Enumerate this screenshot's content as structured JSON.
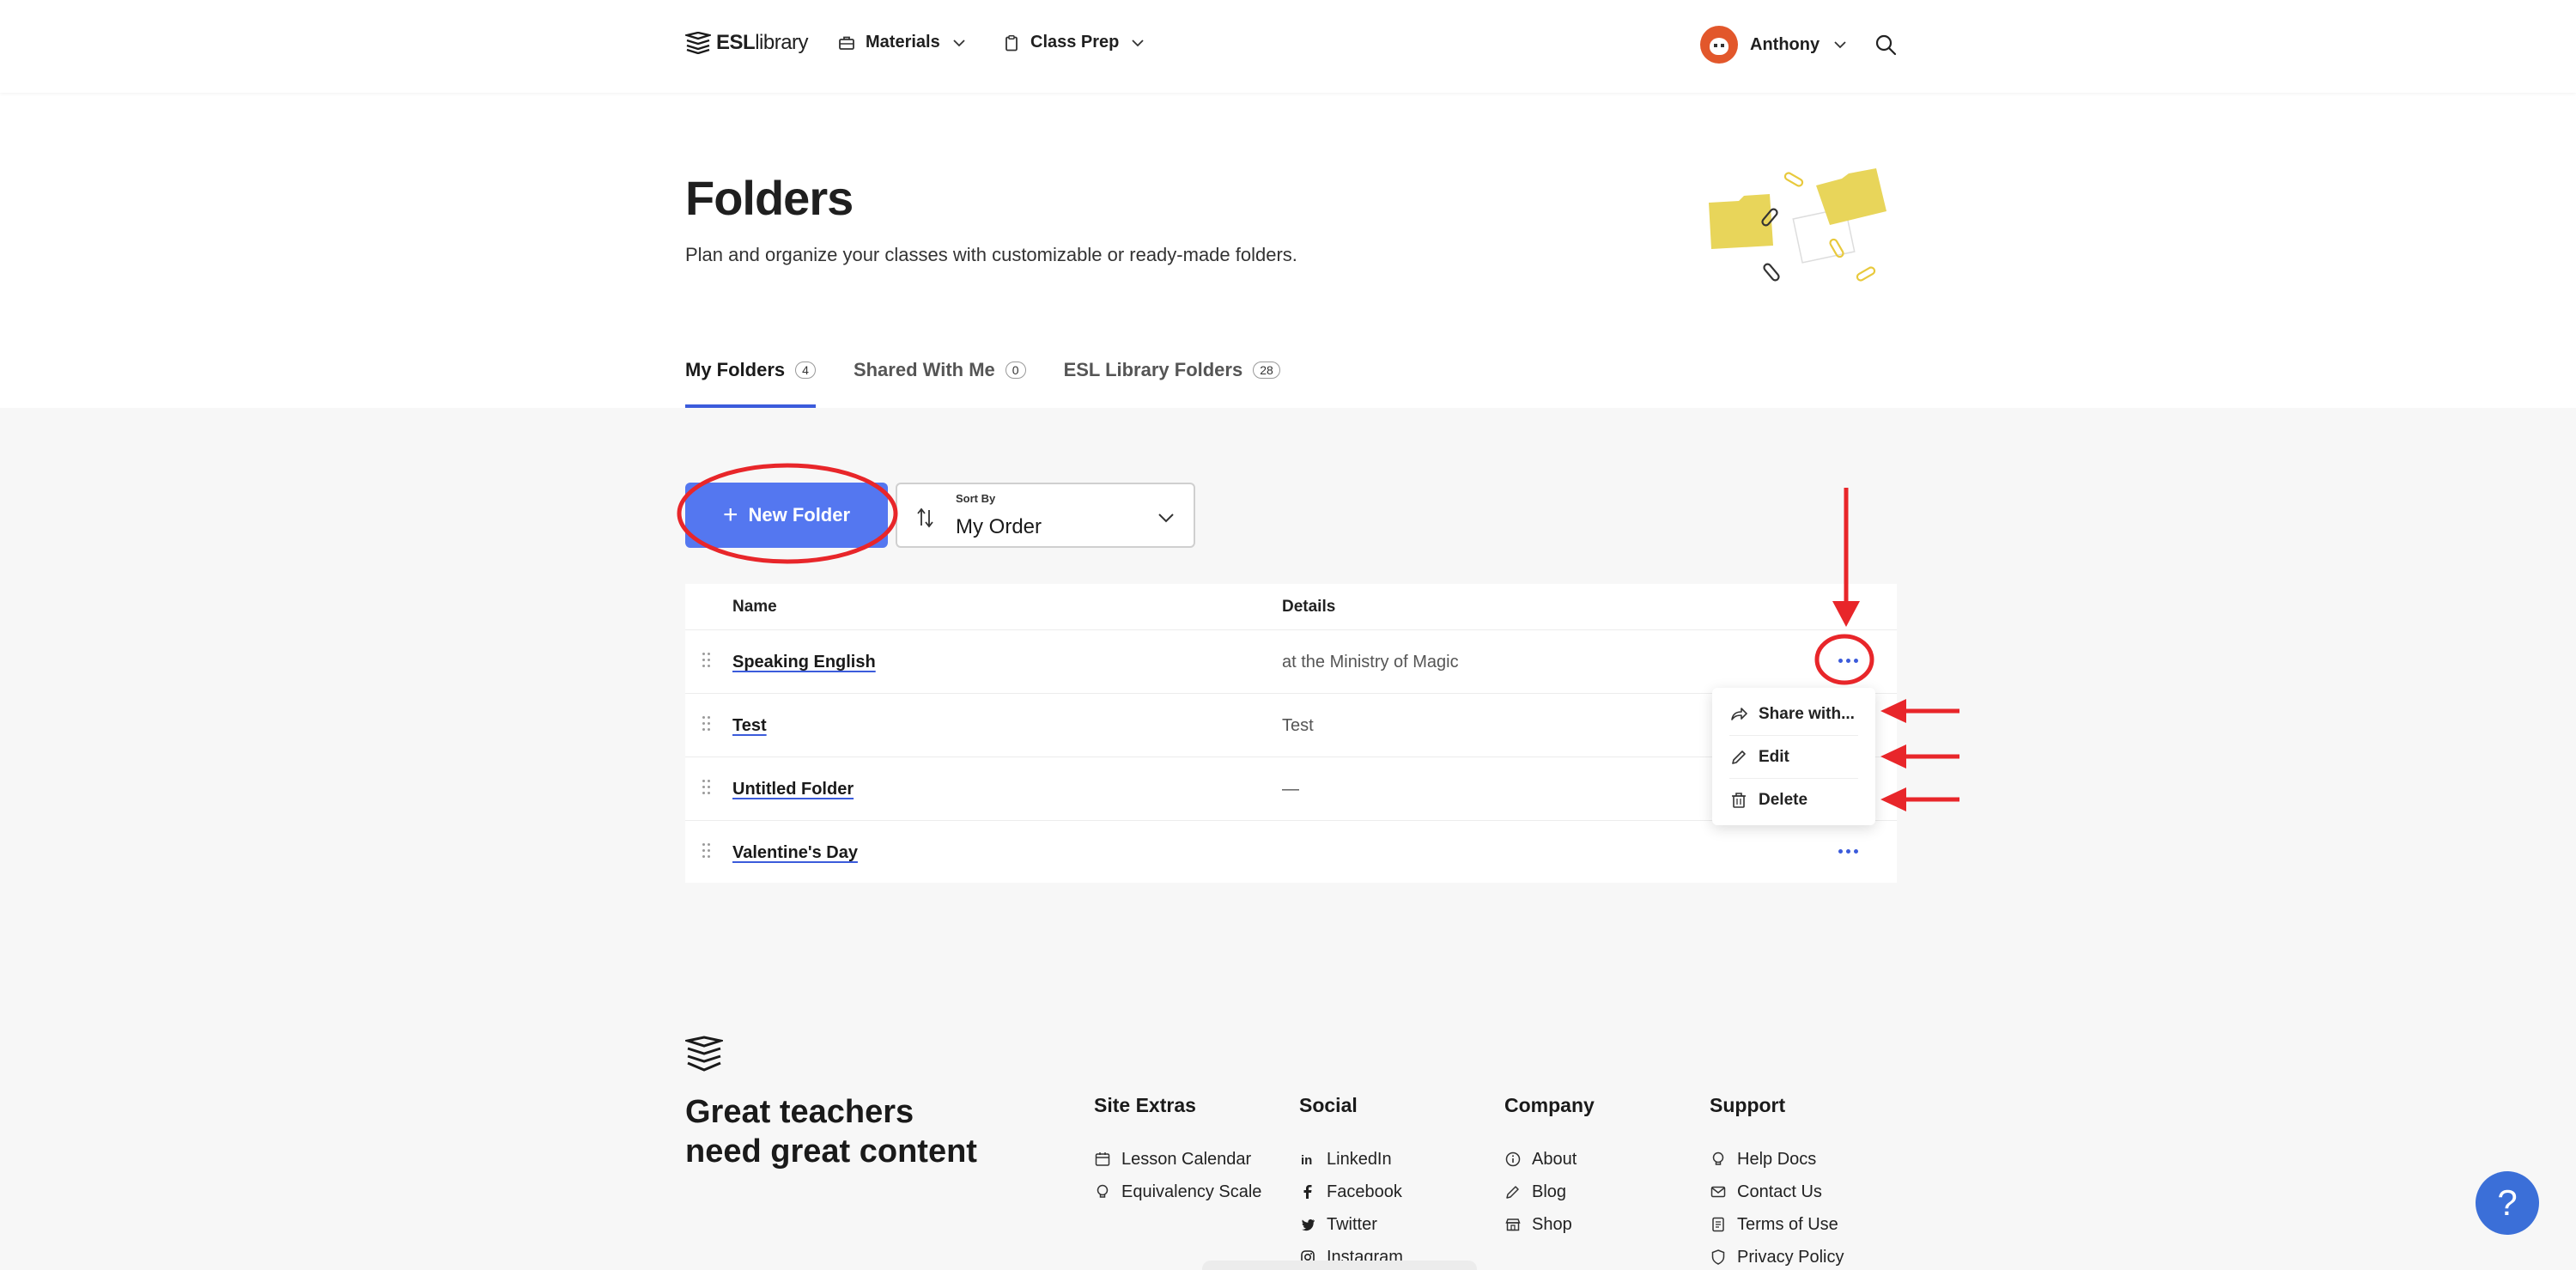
{
  "brand": {
    "logo_bold": "ESL",
    "logo_rest": "library"
  },
  "nav": [
    {
      "label": "Materials",
      "icon": "briefcase-icon"
    },
    {
      "label": "Class Prep",
      "icon": "clipboard-icon"
    }
  ],
  "user": {
    "name": "Anthony"
  },
  "hero": {
    "title": "Folders",
    "subtitle": "Plan and organize your classes with customizable or ready-made folders."
  },
  "tabs": [
    {
      "label": "My Folders",
      "count": "4",
      "active": true
    },
    {
      "label": "Shared With Me",
      "count": "0",
      "active": false
    },
    {
      "label": "ESL Library Folders",
      "count": "28",
      "active": false
    }
  ],
  "toolbar": {
    "new_folder_label": "New Folder",
    "sort_label": "Sort By",
    "sort_value": "My Order"
  },
  "table": {
    "columns": [
      "Name",
      "Details"
    ],
    "rows": [
      {
        "name": "Speaking English",
        "details": "at the Ministry of Magic"
      },
      {
        "name": "Test",
        "details": "Test"
      },
      {
        "name": "Untitled Folder",
        "details": "—"
      },
      {
        "name": "Valentine's Day",
        "details": ""
      }
    ]
  },
  "row_menu": {
    "items": [
      {
        "label": "Share with...",
        "icon": "share-icon"
      },
      {
        "label": "Edit",
        "icon": "pencil-icon"
      },
      {
        "label": "Delete",
        "icon": "trash-icon"
      }
    ]
  },
  "footer": {
    "tagline_line1": "Great teachers",
    "tagline_line2": "need great content",
    "columns": [
      {
        "title": "Site Extras",
        "links": [
          {
            "label": "Lesson Calendar",
            "icon": "calendar-icon"
          },
          {
            "label": "Equivalency Scale",
            "icon": "lightbulb-icon"
          }
        ]
      },
      {
        "title": "Social",
        "links": [
          {
            "label": "LinkedIn",
            "icon": "linkedin-icon"
          },
          {
            "label": "Facebook",
            "icon": "facebook-icon"
          },
          {
            "label": "Twitter",
            "icon": "twitter-icon"
          },
          {
            "label": "Instagram",
            "icon": "instagram-icon"
          }
        ]
      },
      {
        "title": "Company",
        "links": [
          {
            "label": "About",
            "icon": "info-icon"
          },
          {
            "label": "Blog",
            "icon": "pencil-icon"
          },
          {
            "label": "Shop",
            "icon": "shop-icon"
          }
        ]
      },
      {
        "title": "Support",
        "links": [
          {
            "label": "Help Docs",
            "icon": "lightbulb-icon"
          },
          {
            "label": "Contact Us",
            "icon": "mail-icon"
          },
          {
            "label": "Terms of Use",
            "icon": "document-icon"
          },
          {
            "label": "Privacy Policy",
            "icon": "shield-icon"
          }
        ]
      }
    ]
  },
  "help": {
    "label": "?"
  },
  "colors": {
    "accent": "#5477f0",
    "link_underline": "#3b5bdb",
    "annotation": "#e8262a",
    "help": "#3b6fd8"
  }
}
